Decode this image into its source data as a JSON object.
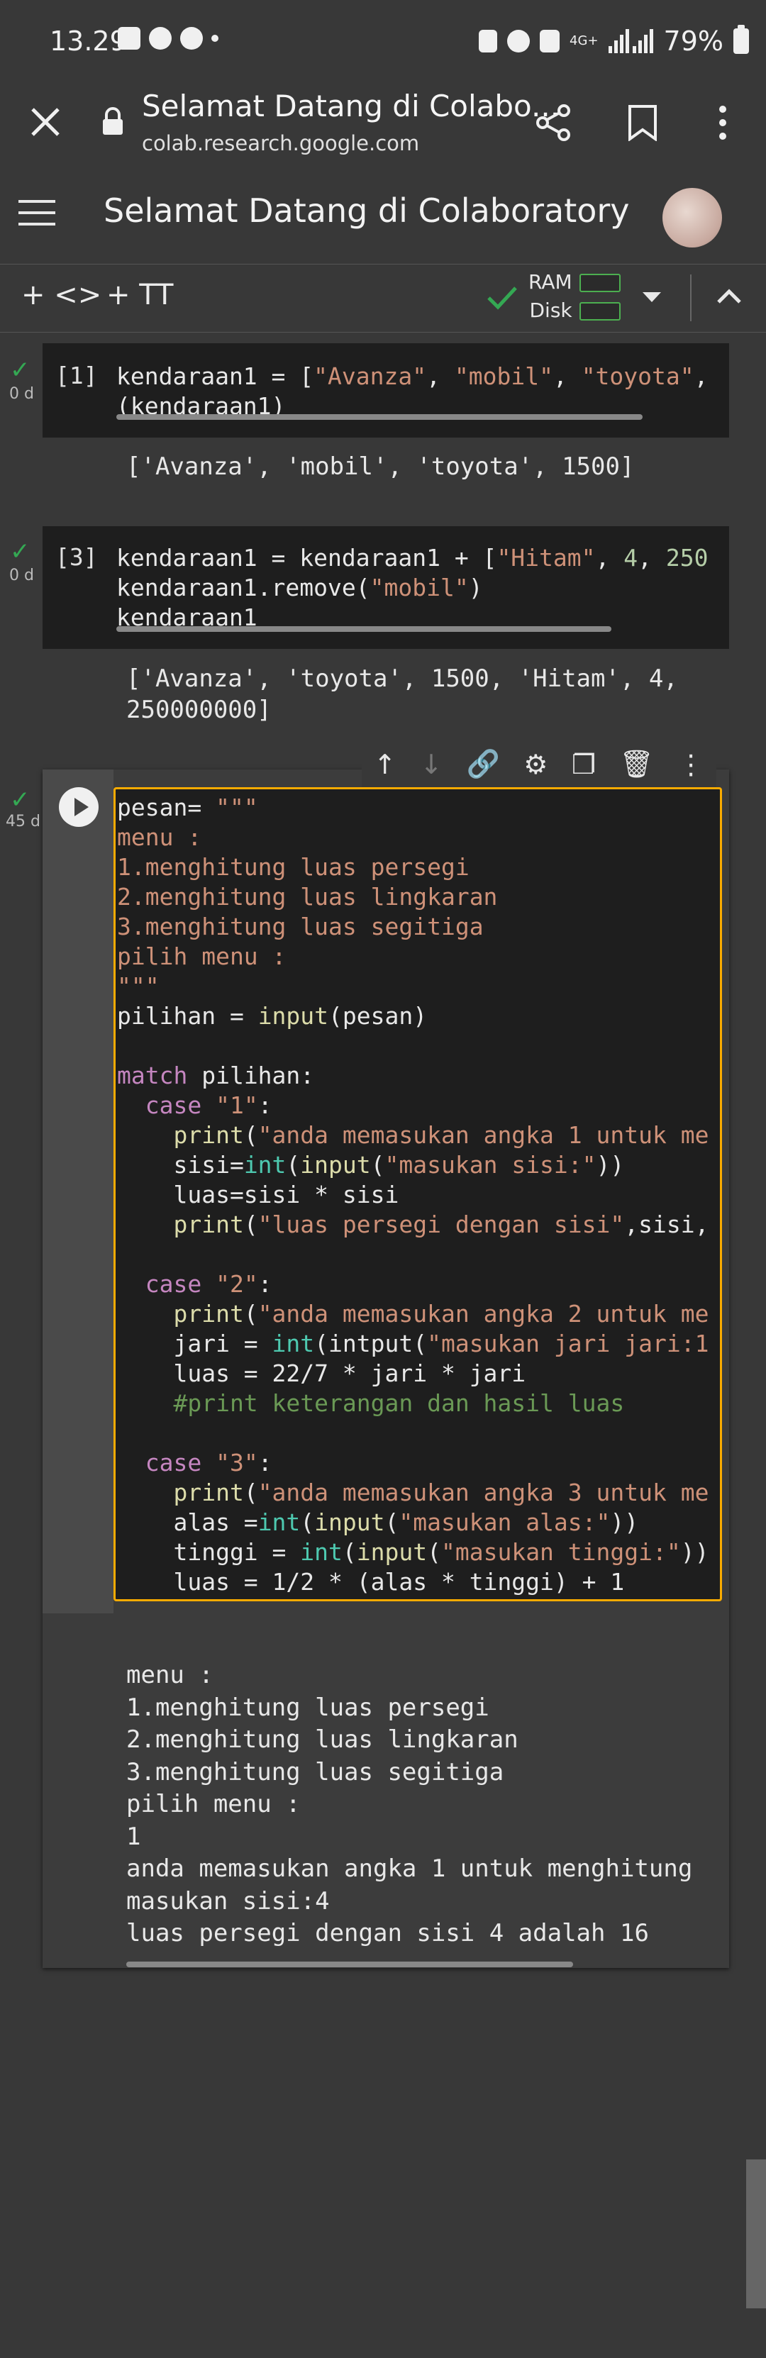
{
  "status_bar": {
    "time": "13.29",
    "battery": "79%",
    "signal": "4G+"
  },
  "browser": {
    "title": "Selamat Datang di Colabo...",
    "url": "colab.research.google.com",
    "icons": [
      "close-icon",
      "lock-icon",
      "share-icon",
      "bookmark-icon",
      "more-vert-icon"
    ]
  },
  "header": {
    "title": "Selamat Datang di Colaboratory",
    "icons": [
      "menu-icon",
      "avatar"
    ]
  },
  "toolbar": {
    "code_label": "+ <>",
    "text_label": "+ TT",
    "ram_label": "RAM",
    "disk_label": "Disk"
  },
  "cells": [
    {
      "exec_count": "[1]",
      "status": "0 d",
      "output": "['Avanza', 'mobil', 'toyota', 1500]"
    },
    {
      "exec_count": "[3]",
      "status": "0 d",
      "output": "['Avanza', 'toyota', 1500, 'Hitam', 4,\n250000000]"
    },
    {
      "status": "45 d",
      "output": "menu :\n1.menghitung luas persegi\n2.menghitung luas lingkaran\n3.menghitung luas segitiga\npilih menu :\n1\nanda memasukan angka 1 untuk menghitung\nmasukan sisi:4\nluas persegi dengan sisi 4 adalah 16"
    }
  ],
  "code": {
    "c1_l1_a": "kendaraan1 = [",
    "c1_l1_s1": "\"Avanza\"",
    "c1_l1_sep1": ", ",
    "c1_l1_s2": "\"mobil\"",
    "c1_l1_sep2": ", ",
    "c1_l1_s3": "\"toyota\"",
    "c1_l1_end": ",",
    "c1_l2": "(kendaraan1)",
    "c2_l1_a": "kendaraan1 = kendaraan1 + [",
    "c2_l1_s1": "\"Hitam\"",
    "c2_l1_sep": ", ",
    "c2_l1_n1": "4",
    "c2_l1_sep2": ", ",
    "c2_l1_n2": "250",
    "c2_l2_a": "kendaraan1.remove(",
    "c2_l2_s": "\"mobil\"",
    "c2_l2_b": ")",
    "c2_l3": "kendaraan1",
    "c3_l1_a": "pesan= ",
    "c3_l1_s": "\"\"\"",
    "c3_l2": "menu :",
    "c3_l3": "1.menghitung luas persegi",
    "c3_l4": "2.menghitung luas lingkaran",
    "c3_l5": "3.menghitung luas segitiga",
    "c3_l6": "pilih menu :",
    "c3_l7": "\"\"\"",
    "c3_l8_a": "pilihan = ",
    "c3_l8_fn": "input",
    "c3_l8_b": "(pesan)",
    "c3_l10_kw": "match",
    "c3_l10_b": " pilihan:",
    "c3_l11_kw": "  case",
    "c3_l11_s": " \"1\"",
    "c3_l11_b": ":",
    "c3_l12_fn": "    print",
    "c3_l12_b": "(",
    "c3_l12_s": "\"anda memasukan angka 1 untuk me",
    "c3_l13_a": "    sisi=",
    "c3_l13_bi": "int",
    "c3_l13_b": "(",
    "c3_l13_fn": "input",
    "c3_l13_c": "(",
    "c3_l13_s": "\"masukan sisi:\"",
    "c3_l13_d": "))",
    "c3_l14": "    luas=sisi * sisi",
    "c3_l15_fn": "    print",
    "c3_l15_b": "(",
    "c3_l15_s": "\"luas persegi dengan sisi\"",
    "c3_l15_c": ",sisi,",
    "c3_l17_kw": "  case",
    "c3_l17_s": " \"2\"",
    "c3_l17_b": ":",
    "c3_l18_fn": "    print",
    "c3_l18_b": "(",
    "c3_l18_s": "\"anda memasukan angka 2 untuk me",
    "c3_l19_a": "    jari = ",
    "c3_l19_bi": "int",
    "c3_l19_b": "(intput(",
    "c3_l19_s": "\"masukan jari jari:1",
    "c3_l20": "    luas = 22/7 * jari * jari",
    "c3_l21": "    #print keterangan dan hasil luas",
    "c3_l23_kw": "  case",
    "c3_l23_s": " \"3\"",
    "c3_l23_b": ":",
    "c3_l24_fn": "    print",
    "c3_l24_b": "(",
    "c3_l24_s": "\"anda memasukan angka 3 untuk me",
    "c3_l25_a": "    alas =",
    "c3_l25_bi": "int",
    "c3_l25_b": "(",
    "c3_l25_fn": "input",
    "c3_l25_c": "(",
    "c3_l25_s": "\"masukan alas:\"",
    "c3_l25_d": "))",
    "c3_l26_a": "    tinggi = ",
    "c3_l26_bi": "int",
    "c3_l26_b": "(",
    "c3_l26_fn": "input",
    "c3_l26_c": "(",
    "c3_l26_s": "\"masukan tinggi:\"",
    "c3_l26_d": "))",
    "c3_l27": "    luas = 1/2 * (alas * tinggi) + 1"
  },
  "colors": {
    "accent": "#f9ab00",
    "ok": "#34a853",
    "background": "#383838"
  }
}
